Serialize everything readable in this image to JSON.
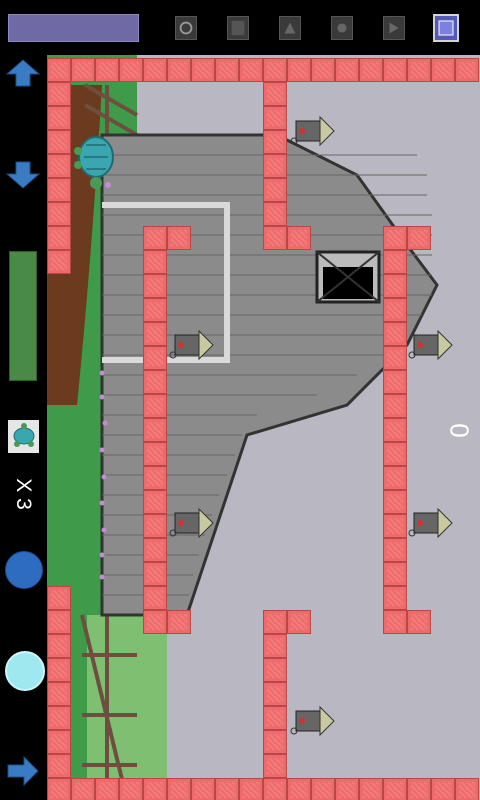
{
  "hud": {
    "lives_label": "X 3",
    "score": "0"
  },
  "colors": {
    "progress": "#6f6aa6",
    "power": "#4a8a47",
    "brick": "#ef6b6b",
    "arrow": "#3a7cc4",
    "primary_button": "#2e6cbf",
    "secondary_button": "#9fe8f0"
  },
  "toolbar": {
    "tools": [
      "tool-1",
      "tool-2",
      "tool-3",
      "tool-4",
      "tool-5",
      "tool-active"
    ]
  },
  "icons": {
    "up": "arrow-up-icon",
    "down": "arrow-down-icon",
    "right": "arrow-right-icon",
    "life": "turtle-icon"
  }
}
